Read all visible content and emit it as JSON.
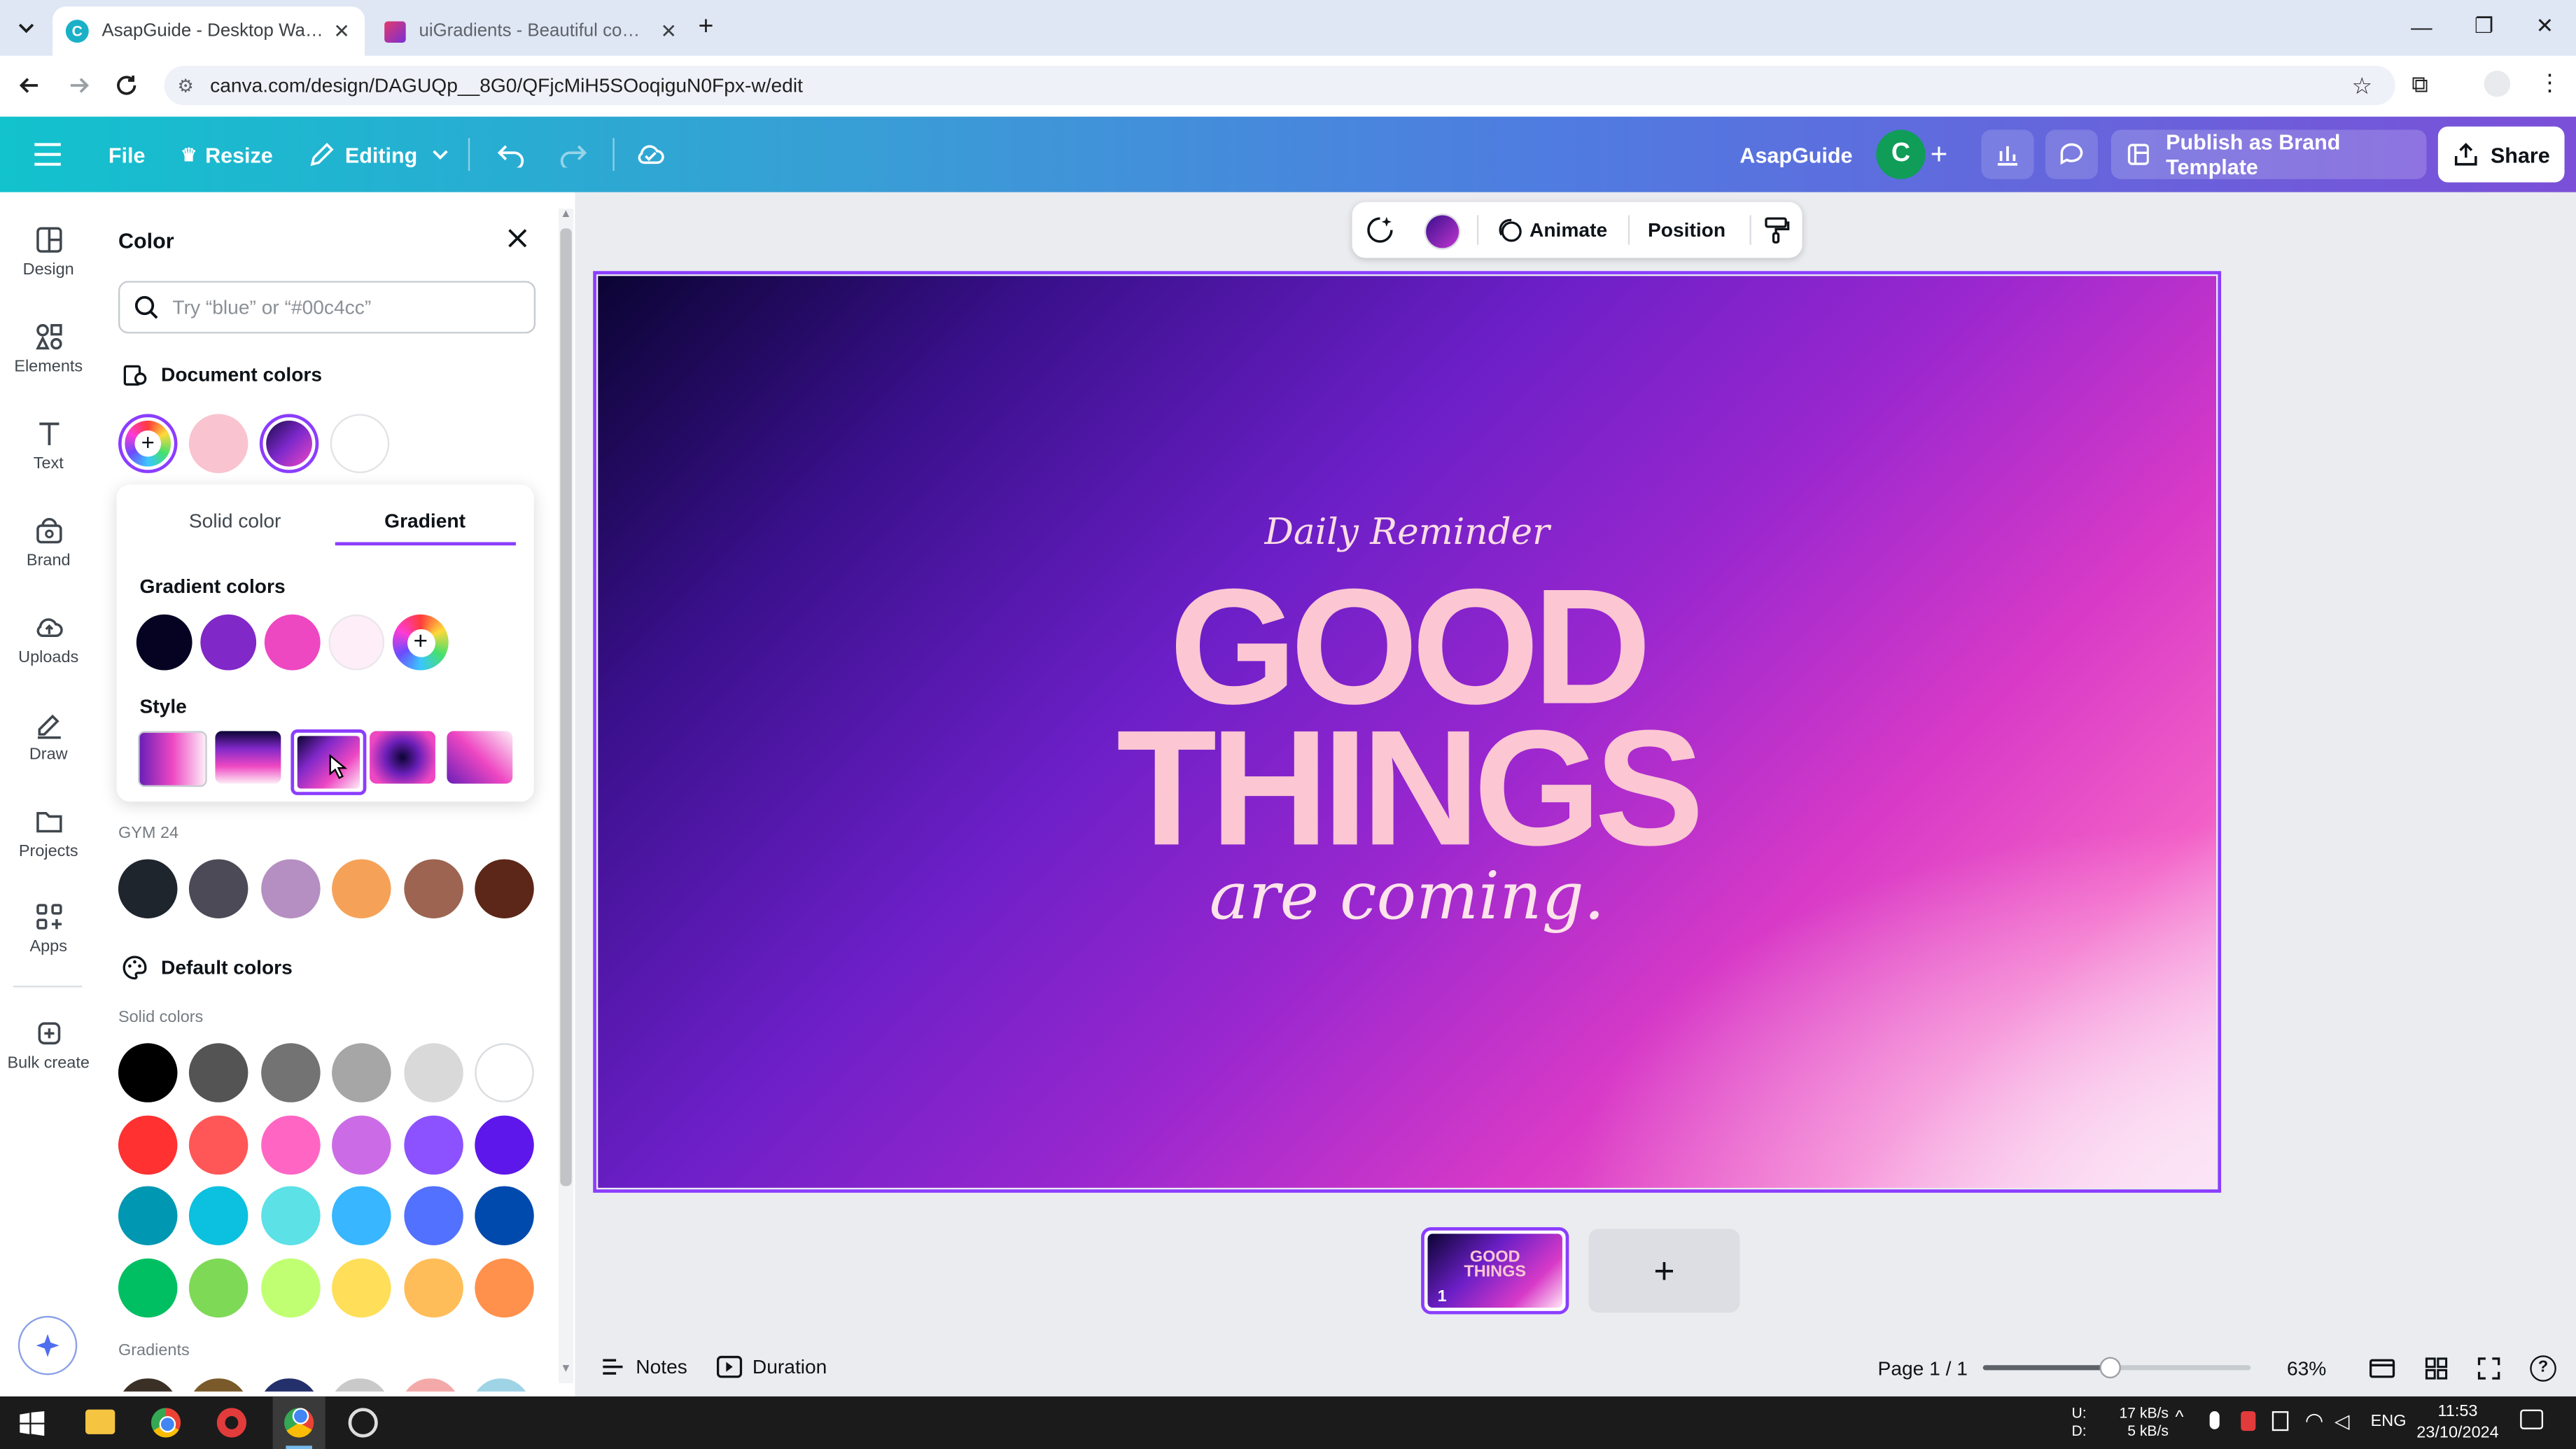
{
  "browser": {
    "tabs": [
      {
        "title": "AsapGuide - Desktop Wallpape",
        "active": true
      },
      {
        "title": "uiGradients - Beautiful colored",
        "active": false
      }
    ],
    "url": "canva.com/design/DAGUQp__8G0/QFjcMiH5SOoqiguN0Fpx-w/edit"
  },
  "header": {
    "file": "File",
    "resize": "Resize",
    "editing": "Editing",
    "team_name": "AsapGuide",
    "avatar_letter": "C",
    "publish": "Publish as Brand Template",
    "share": "Share"
  },
  "rail": {
    "items": [
      "Design",
      "Elements",
      "Text",
      "Brand",
      "Uploads",
      "Draw",
      "Projects",
      "Apps",
      "Bulk create"
    ]
  },
  "panel": {
    "title": "Color",
    "search_placeholder": "Try “blue” or “#00c4cc”",
    "document_colors": "Document colors",
    "doc_swatches": [
      "#f9c3cf",
      "gradient",
      "#ffffff"
    ],
    "tabs": {
      "solid": "Solid color",
      "gradient": "Gradient"
    },
    "gradient_colors_label": "Gradient colors",
    "gradient_colors": [
      "#060322",
      "#8128c9",
      "#ee47c2",
      "#fdeef7"
    ],
    "style_label": "Style",
    "brand_kit": "GYM 24",
    "brand_colors": [
      "#1f252d",
      "#4d4a58",
      "#b58fc1",
      "#f5a258",
      "#9c6451",
      "#5c2618"
    ],
    "default_colors": "Default colors",
    "solid_colors_label": "Solid colors",
    "solid_colors": [
      [
        "#000000",
        "#545454",
        "#737373",
        "#a6a6a6",
        "#d9d9d9",
        "#ffffff"
      ],
      [
        "#ff3131",
        "#ff5757",
        "#ff66c4",
        "#cb6ce6",
        "#8c52ff",
        "#5e17eb"
      ],
      [
        "#0097b2",
        "#0cc0df",
        "#5ce1e6",
        "#38b6ff",
        "#5271ff",
        "#004aad"
      ],
      [
        "#00bf63",
        "#7ed957",
        "#c1ff72",
        "#ffde59",
        "#ffbd59",
        "#ff914d"
      ]
    ],
    "gradients_label": "Gradients"
  },
  "context_toolbar": {
    "animate": "Animate",
    "position": "Position"
  },
  "design": {
    "subtitle": "Daily Reminder",
    "line1": "GOOD",
    "line2": "THINGS",
    "line3": "are coming."
  },
  "pages": {
    "thumb_number": "1",
    "thumb_line1": "GOOD",
    "thumb_line2": "THINGS"
  },
  "footer": {
    "notes": "Notes",
    "duration": "Duration",
    "page": "Page 1 / 1",
    "zoom": "63%",
    "zoom_level": 0.63
  },
  "taskbar": {
    "net_up_label": "U:",
    "net_down_label": "D:",
    "net_up": "17 kB/s",
    "net_down": "5 kB/s",
    "lang": "ENG",
    "time": "11:53",
    "date": "23/10/2024"
  }
}
